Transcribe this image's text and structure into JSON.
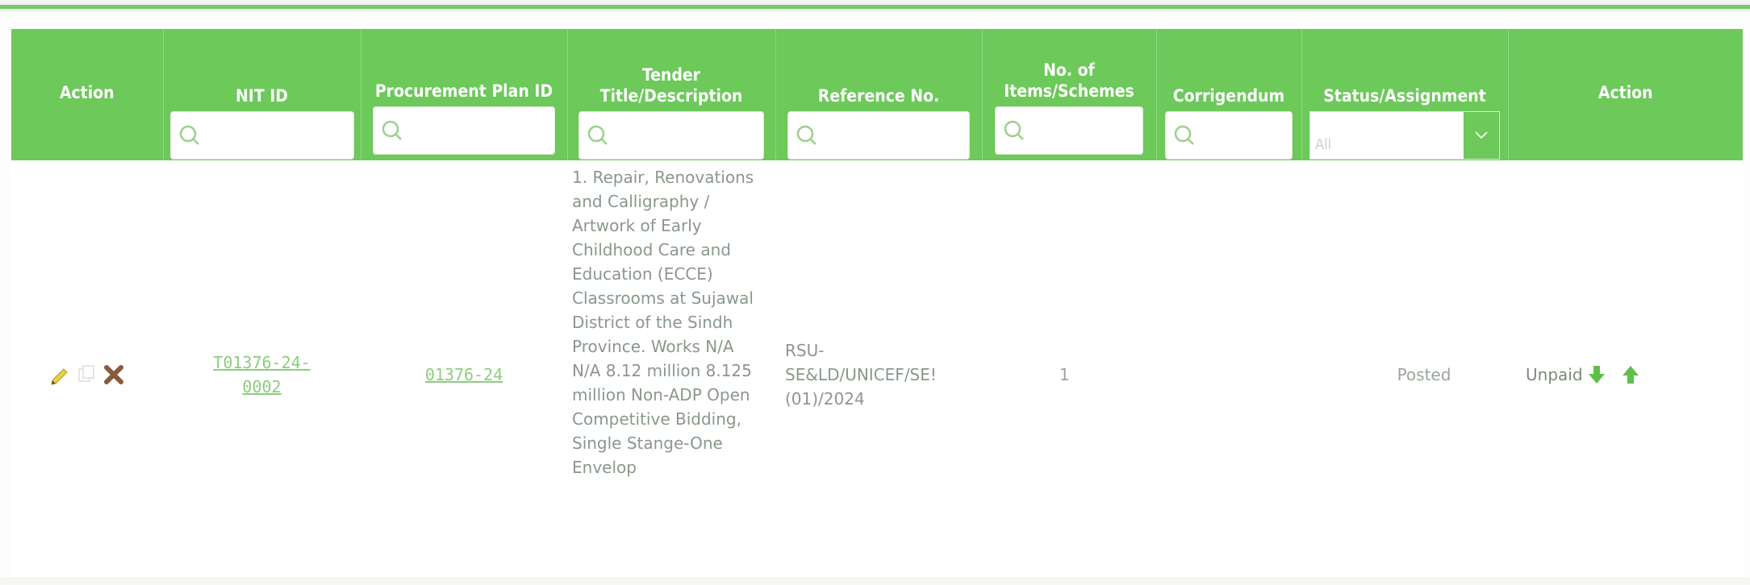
{
  "table": {
    "columns": [
      {
        "key": "action_left",
        "label": "Action",
        "filter": "none"
      },
      {
        "key": "nit_id",
        "label": "NIT ID",
        "filter": "search"
      },
      {
        "key": "procurement_plan_id",
        "label": "Procurement Plan ID",
        "filter": "search"
      },
      {
        "key": "tender_title",
        "label": "Tender Title/Description",
        "filter": "search"
      },
      {
        "key": "reference_no",
        "label": "Reference No.",
        "filter": "search"
      },
      {
        "key": "items_schemes",
        "label": "No. of Items/Schemes",
        "filter": "search"
      },
      {
        "key": "corrigendum",
        "label": "Corrigendum",
        "filter": "search"
      },
      {
        "key": "status",
        "label": "Status/Assignment",
        "filter": "select"
      },
      {
        "key": "action_right",
        "label": "Action",
        "filter": "none"
      }
    ],
    "status_filter": {
      "selected": "All"
    },
    "rows": [
      {
        "row_icons": [
          "pencil-icon",
          "copy-icon",
          "delete-x-icon"
        ],
        "nit_id_line1": "T01376-24-",
        "nit_id_line2": "0002",
        "procurement_plan_id": "01376-24",
        "tender_title": "1. Repair, Renovations and Calligraphy / Artwork of Early Childhood Care and Education (ECCE) Classrooms at Sujawal District of the Sindh Province. Works N/A N/A 8.12 million 8.125 million Non-ADP Open Competitive Bidding, Single Stange-One Envelop",
        "reference_line1": "RSU-",
        "reference_line2": "SE&LD/UNICEF/SE!",
        "reference_line3": "(01)/2024",
        "items_schemes": "1",
        "corrigendum": "",
        "status": "Posted",
        "payment": "Unpaid",
        "payment_icons": [
          "download-arrow-icon",
          "upload-arrow-icon"
        ]
      }
    ]
  },
  "colors": {
    "header_green": "#6cc95a",
    "link_green": "#8ccd7e",
    "top_line": "#7ac96a",
    "arrow_green": "#5fbf4a"
  }
}
